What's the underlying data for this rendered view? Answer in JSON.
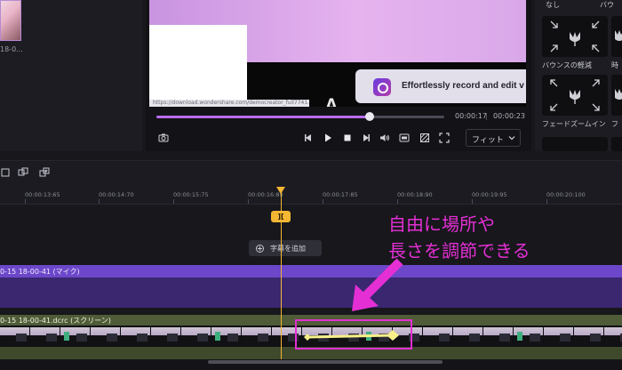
{
  "media": {
    "thumb_label": "18-0..."
  },
  "preview": {
    "url_text": "https://download.wondershare.com/democreator_full7741.exe",
    "big_text": "A            ",
    "promo_text": "Effortlessly record and edit v",
    "progress_fraction": 0.74,
    "time_current": "00:00:17",
    "time_separator": "|",
    "time_total": "00:00:23",
    "fit_label": "フィット"
  },
  "effects": {
    "tabs": [
      "なし",
      "バウ"
    ],
    "cards": [
      {
        "label": "バウンスの軽減",
        "icon": "tulip-arrows-in-icon"
      },
      {
        "label": "時",
        "icon": "tulip-icon"
      },
      {
        "label": "フェードズームイン",
        "icon": "tulip-arrows-out-icon"
      },
      {
        "label": "フ",
        "icon": "tulip-icon"
      }
    ]
  },
  "timeline": {
    "ruler_ticks": [
      "00:00:13:65",
      "00:00:14:70",
      "00:00:15:75",
      "00:00:16:80",
      "00:00:17:85",
      "00:00:18:90",
      "00:00:19:95",
      "00:00:20:100"
    ],
    "split_marker": "][",
    "add_caption_label": "字幕を追加",
    "audio_track_label": "0-15 18-00-41 (マイク)",
    "video_track_label": "0-15 18-00-41.dcrc (スクリーン)"
  },
  "annotation": {
    "line1": "自由に場所や",
    "line2": "長さを調節できる",
    "color": "#e42fd4"
  },
  "colors": {
    "accent": "#b86cf0",
    "playhead": "#f3b733",
    "audio_track": "#6c47c9",
    "video_track": "#4f5c37"
  }
}
